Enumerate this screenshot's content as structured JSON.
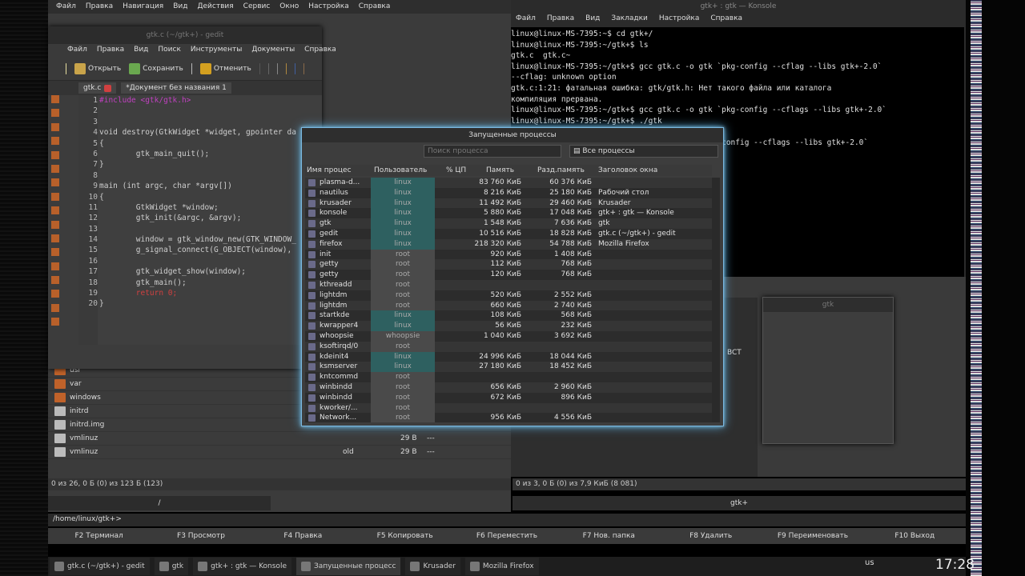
{
  "krusader": {
    "menu": [
      "Файл",
      "Правка",
      "Навигация",
      "Вид",
      "Действия",
      "Сервис",
      "Окно",
      "Настройка",
      "Справка"
    ],
    "left_rows": [
      {
        "name": "usr",
        "ext": "",
        "size": "",
        "date": ""
      },
      {
        "name": "var",
        "ext": "",
        "size": "",
        "date": ""
      },
      {
        "name": "windows",
        "ext": "",
        "size": "",
        "date": ""
      },
      {
        "name": "initrd",
        "ext": "",
        "size": "",
        "date": ""
      },
      {
        "name": "initrd.img",
        "ext": "",
        "size": "",
        "date": ""
      },
      {
        "name": "vmlinuz",
        "ext": "",
        "size": "29 B",
        "date": "---"
      },
      {
        "name": "vmlinuz",
        "ext": "old",
        "size": "29 B",
        "date": "---"
      }
    ],
    "left_status": "0 из 26, 0 Б (0) из 123 Б (123)",
    "right_status": "0 из 3, 0 Б (0) из 7,9 КиБ (8 081)",
    "left_path": "/",
    "right_path": "gtk+",
    "cmd_path": "/home/linux/gtk+>",
    "right_label": "BCT",
    "fkeys": [
      "F2 Терминал",
      "F3 Просмотр",
      "F4 Правка",
      "F5 Копировать",
      "F6 Переместить",
      "F7 Нов. папка",
      "F8 Удалить",
      "F9 Переименовать",
      "F10 Выход"
    ]
  },
  "gedit": {
    "title": "gtk.c (~/gtk+) - gedit",
    "menu": [
      "Файл",
      "Правка",
      "Вид",
      "Поиск",
      "Инструменты",
      "Документы",
      "Справка"
    ],
    "toolbar": {
      "open": "Открыть",
      "save": "Сохранить",
      "undo": "Отменить"
    },
    "tabs": [
      "gtk.c",
      "*Документ без названия 1"
    ],
    "line_numbers": [
      "1",
      "2",
      "3",
      "4",
      "5",
      "6",
      "7",
      "8",
      "9",
      "10",
      "11",
      "12",
      "13",
      "14",
      "15",
      "16",
      "17",
      "18",
      "19",
      "20"
    ],
    "code": [
      "#include <gtk/gtk.h>",
      "",
      "",
      "void destroy(GtkWidget *widget, gpointer da",
      "{",
      "        gtk_main_quit();",
      "}",
      "",
      "main (int argc, char *argv[])",
      "{",
      "        GtkWidget *window;",
      "        gtk_init(&argc, &argv);",
      "",
      "        window = gtk_window_new(GTK_WINDOW_",
      "        g_signal_connect(G_OBJECT(window),",
      "",
      "        gtk_widget_show(window);",
      "        gtk_main();",
      "        return 0;",
      "}"
    ]
  },
  "konsole": {
    "title": "gtk+ : gtk — Konsole",
    "menu": [
      "Файл",
      "Правка",
      "Вид",
      "Закладки",
      "Настройка",
      "Справка"
    ],
    "lines": [
      "linux@linux-MS-7395:~$ cd gtk+/",
      "linux@linux-MS-7395:~/gtk+$ ls",
      "gtk.c  gtk.c~",
      "linux@linux-MS-7395:~/gtk+$ gcc gtk.c -o gtk `pkg-config --cflag --libs gtk+-2.0`",
      "--cflag: unknown option",
      "gtk.c:1:21: фатальная ошибка: gtk/gtk.h: Нет такого файла или каталога",
      "компиляция прервана.",
      "linux@linux-MS-7395:~/gtk+$ gcc gtk.c -o gtk `pkg-config --cflags --libs gtk+-2.0`",
      "linux@linux-MS-7395:~/gtk+$ ./gtk",
      "",
      "                                     gtk `pkg-config --cflags --libs gtk+-2.0`"
    ]
  },
  "gtk_window": {
    "title": "gtk"
  },
  "process": {
    "title": "Запущенные процессы",
    "search_placeholder": "Поиск процесса",
    "filter": "Все процессы",
    "headers": [
      "Имя процес",
      "Пользователь",
      "% ЦП",
      "Память",
      "Разд.память",
      "Заголовок окна"
    ],
    "rows": [
      {
        "name": "plasma-d...",
        "user": "linux",
        "mem": "83 760 КиБ",
        "shared": "60 376 КиБ",
        "title": "",
        "u": "linux"
      },
      {
        "name": "nautilus",
        "user": "linux",
        "mem": "8 216 КиБ",
        "shared": "25 180 КиБ",
        "title": "Рабочий стол",
        "u": "linux"
      },
      {
        "name": "krusader",
        "user": "linux",
        "mem": "11 492 КиБ",
        "shared": "29 460 КиБ",
        "title": "Krusader",
        "u": "linux"
      },
      {
        "name": "konsole",
        "user": "linux",
        "mem": "5 880 КиБ",
        "shared": "17 048 КиБ",
        "title": "gtk+ : gtk — Konsole",
        "u": "linux"
      },
      {
        "name": "gtk",
        "user": "linux",
        "mem": "1 548 КиБ",
        "shared": "7 636 КиБ",
        "title": "gtk",
        "u": "linux"
      },
      {
        "name": "gedit",
        "user": "linux",
        "mem": "10 516 КиБ",
        "shared": "18 828 КиБ",
        "title": "gtk.c (~/gtk+) - gedit",
        "u": "linux"
      },
      {
        "name": "firefox",
        "user": "linux",
        "mem": "218 320 КиБ",
        "shared": "54 788 КиБ",
        "title": "Mozilla Firefox",
        "u": "linux"
      },
      {
        "name": "init",
        "user": "root",
        "mem": "920 КиБ",
        "shared": "1 408 КиБ",
        "title": "",
        "u": "root"
      },
      {
        "name": "getty",
        "user": "root",
        "mem": "112 КиБ",
        "shared": "768 КиБ",
        "title": "",
        "u": "root"
      },
      {
        "name": "getty",
        "user": "root",
        "mem": "120 КиБ",
        "shared": "768 КиБ",
        "title": "",
        "u": "root"
      },
      {
        "name": "kthreadd",
        "user": "root",
        "mem": "",
        "shared": "",
        "title": "",
        "u": "root"
      },
      {
        "name": "lightdm",
        "user": "root",
        "mem": "520 КиБ",
        "shared": "2 552 КиБ",
        "title": "",
        "u": "root"
      },
      {
        "name": "lightdm",
        "user": "root",
        "mem": "660 КиБ",
        "shared": "2 740 КиБ",
        "title": "",
        "u": "root"
      },
      {
        "name": "startkde",
        "user": "linux",
        "mem": "108 КиБ",
        "shared": "568 КиБ",
        "title": "",
        "u": "linux"
      },
      {
        "name": "kwrapper4",
        "user": "linux",
        "mem": "56 КиБ",
        "shared": "232 КиБ",
        "title": "",
        "u": "linux"
      },
      {
        "name": "whoopsie",
        "user": "whoopsie",
        "mem": "1 040 КиБ",
        "shared": "3 692 КиБ",
        "title": "",
        "u": "root"
      },
      {
        "name": "ksoftirqd/0",
        "user": "root",
        "mem": "",
        "shared": "",
        "title": "",
        "u": "root"
      },
      {
        "name": "kdeinit4",
        "user": "linux",
        "mem": "24 996 КиБ",
        "shared": "18 044 КиБ",
        "title": "",
        "u": "linux"
      },
      {
        "name": "ksmserver",
        "user": "linux",
        "mem": "27 180 КиБ",
        "shared": "18 452 КиБ",
        "title": "",
        "u": "linux"
      },
      {
        "name": "kntcommd",
        "user": "root",
        "mem": "",
        "shared": "",
        "title": "",
        "u": "root"
      },
      {
        "name": "winbindd",
        "user": "root",
        "mem": "656 КиБ",
        "shared": "2 960 КиБ",
        "title": "",
        "u": "root"
      },
      {
        "name": "winbindd",
        "user": "root",
        "mem": "672 КиБ",
        "shared": "896 КиБ",
        "title": "",
        "u": "root"
      },
      {
        "name": "kworker/...",
        "user": "root",
        "mem": "",
        "shared": "",
        "title": "",
        "u": "root"
      },
      {
        "name": "Network...",
        "user": "root",
        "mem": "956 КиБ",
        "shared": "4 556 КиБ",
        "title": "",
        "u": "root"
      }
    ]
  },
  "taskbar": {
    "items": [
      "gtk.c (~/gtk+) - gedit",
      "gtk",
      "gtk+ : gtk — Konsole",
      "Запущенные процесс",
      "Krusader",
      "Mozilla Firefox"
    ],
    "layout": "us",
    "clock": "17:28"
  }
}
